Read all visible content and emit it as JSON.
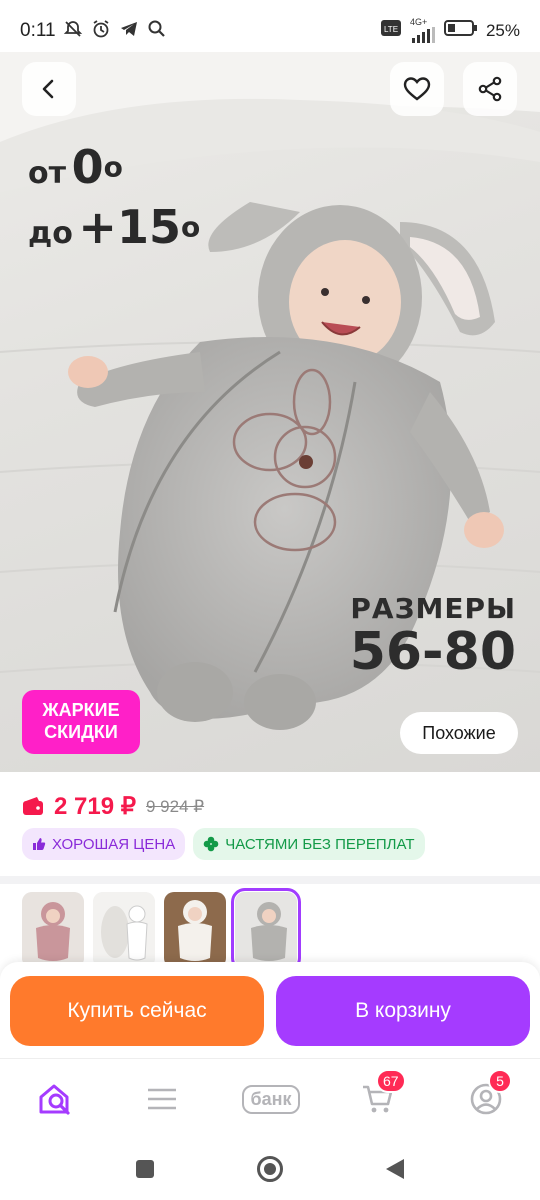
{
  "status_bar": {
    "time": "0:11",
    "battery": "25%",
    "network": "4G+",
    "icons_left": [
      "mute-icon",
      "alarm-icon",
      "telegram-icon",
      "search-icon"
    ],
    "icons_right": [
      "volte-icon",
      "signal-icon",
      "battery-icon"
    ]
  },
  "hero": {
    "temp_from_prefix": "от",
    "temp_from_value": "0",
    "temp_to_prefix": "до",
    "temp_to_value": "+15",
    "degree": "o",
    "sizes_title": "РАЗМЕРЫ",
    "sizes_value": "56-80",
    "hot_badge_line1": "ЖАРКИЕ",
    "hot_badge_line2": "СКИДКИ",
    "similar_label": "Похожие"
  },
  "price": {
    "current": "2 719 ₽",
    "old": "9 924 ₽",
    "chip_good": "ХОРОШАЯ ЦЕНА",
    "chip_parts": "ЧАСТЯМИ БЕЗ ПЕРЕПЛАТ"
  },
  "thumbnails": {
    "selected_index": 3,
    "items": [
      "pink",
      "white",
      "white-bear",
      "grey"
    ]
  },
  "actions": {
    "buy_now": "Купить сейчас",
    "add_to_cart": "В корзину"
  },
  "bottom_nav": {
    "bank_label": "банк",
    "cart_badge": "67",
    "profile_badge": "5"
  },
  "colors": {
    "price": "#f5194c",
    "buy": "#ff7a2c",
    "cart": "#a53bff",
    "hot_badge": "#ff20c8"
  }
}
